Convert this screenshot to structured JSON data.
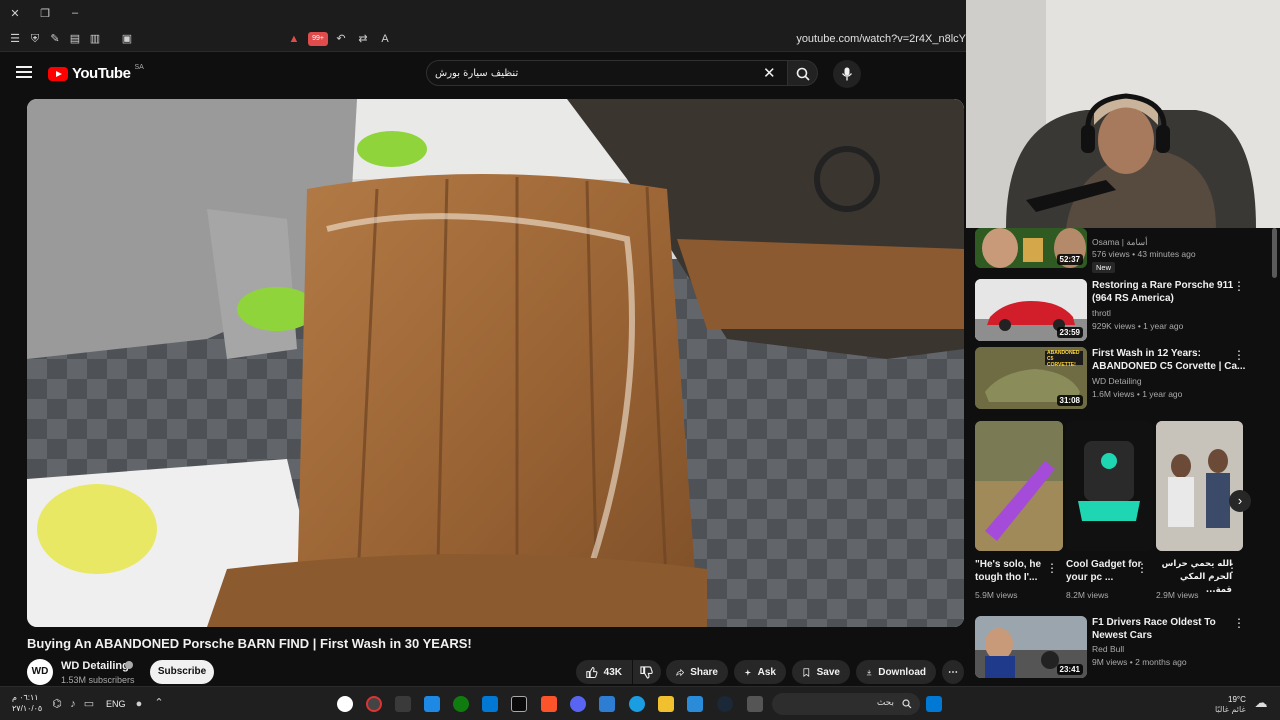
{
  "browser": {
    "url": "youtube.com/watch?v=2r4X_n8lcY",
    "badge_count": "99+"
  },
  "header": {
    "logo_text": "YouTube",
    "country_code": "SA",
    "search_value": "تنظيف سيارة بورش"
  },
  "video": {
    "title": "Buying An ABANDONED Porsche BARN FIND | First Wash in 30 YEARS!",
    "channel": "WD Detailing",
    "avatar_text": "WD",
    "subscribers": "1.53M subscribers",
    "subscribe_label": "Subscribe",
    "likes": "43K",
    "share_label": "Share",
    "ask_label": "Ask",
    "save_label": "Save",
    "download_label": "Download"
  },
  "related": [
    {
      "title": "",
      "channel": "Osama | أسامة",
      "meta": "576 views • 43 minutes ago",
      "duration": "52:37",
      "badge": "New"
    },
    {
      "title": "Restoring a Rare Porsche 911 (964 RS America)",
      "channel": "throtl",
      "meta": "929K views • 1 year ago",
      "duration": "23:59"
    },
    {
      "title": "First Wash in 12 Years: ABANDONED C5 Corvette | Ca...",
      "channel": "WD Detailing",
      "meta": "1.6M views • 1 year ago",
      "duration": "31:08",
      "thumb_label": "ABANDONED C5 CORVETTE!"
    },
    {
      "title": "F1 Drivers Race Oldest To Newest Cars",
      "channel": "Red Bull",
      "meta": "9M views • 2 months ago",
      "duration": "23:41"
    }
  ],
  "shorts": [
    {
      "title": "\"He's solo, he tough tho I'...",
      "views": "5.9M views"
    },
    {
      "title": "Cool Gadget for your pc ...",
      "views": "8.2M views"
    },
    {
      "title": "الله يحمي حراس الحرم المكي قمة...",
      "views": "2.9M views"
    }
  ],
  "taskbar": {
    "time": "٠٦:١١ م",
    "date": "٢٧/١٠/٠٥",
    "language": "ENG",
    "search_placeholder": "بحث",
    "temperature": "19°C",
    "weather": "غائم غالبًا"
  },
  "colors": {
    "accent_red": "#ff0000",
    "background": "#0f0f0f",
    "pill": "#272727"
  }
}
